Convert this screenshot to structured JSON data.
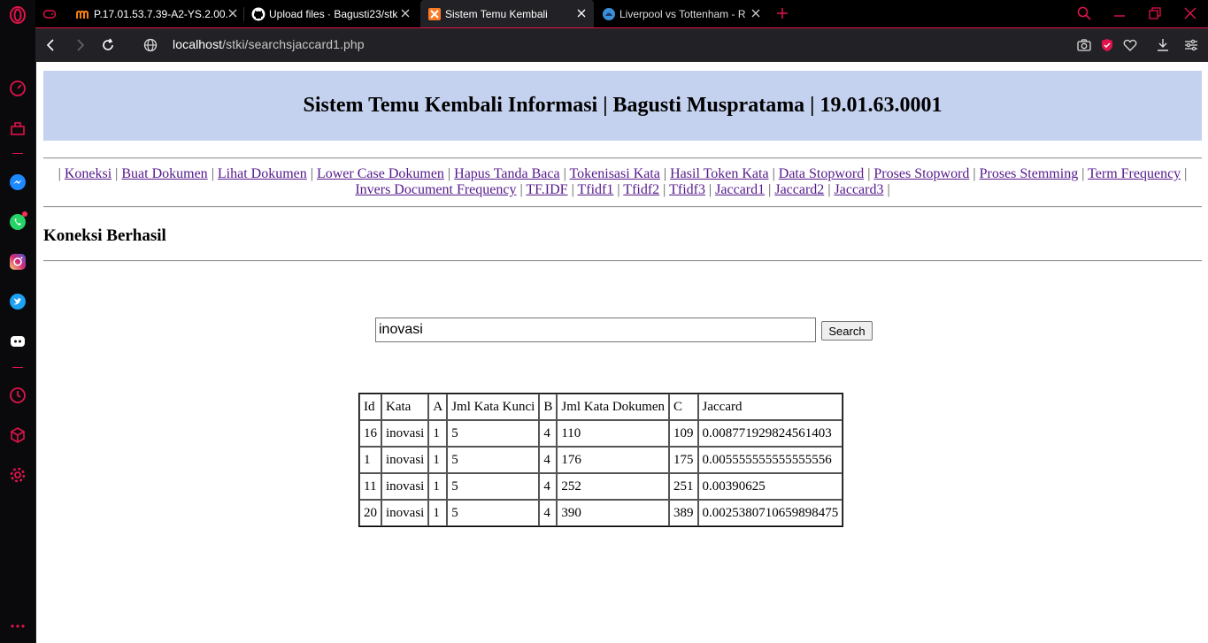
{
  "browser": {
    "tabs": [
      {
        "title": "P.17.01.53.7.39-A2-YS.2.00.",
        "favicon": "moodle-icon"
      },
      {
        "title": "Upload files · Bagusti23/stk",
        "favicon": "github-icon"
      },
      {
        "title": "Sistem Temu Kembali",
        "favicon": "xampp-icon",
        "active": true
      },
      {
        "title": "Liverpool vs Tottenham - R",
        "favicon": "premier-league-icon"
      }
    ],
    "url_host": "localhost",
    "url_path": "/stki/searchsjaccard1.php"
  },
  "header": {
    "title": "Sistem Temu Kembali Informasi | Bagusti Muspratama | 19.01.63.0001",
    "bg_color": "#c5d2ef"
  },
  "nav": {
    "links": [
      "Koneksi",
      "Buat Dokumen",
      "Lihat Dokumen",
      "Lower Case Dokumen",
      "Hapus Tanda Baca",
      "Tokenisasi Kata",
      "Hasil Token Kata",
      "Data Stopword",
      "Proses Stopword",
      "Proses Stemming",
      "Term Frequency",
      "Invers Document Frequency",
      "TF.IDF",
      "Tfidf1",
      "Tfidf2",
      "Tfidf3",
      "Jaccard1",
      "Jaccard2",
      "Jaccard3"
    ],
    "separator": "|"
  },
  "status": {
    "message": "Koneksi Berhasil"
  },
  "search": {
    "value": "inovasi",
    "button_label": "Search"
  },
  "table": {
    "headers": [
      "Id",
      "Kata",
      "A",
      "Jml Kata Kunci",
      "B",
      "Jml Kata Dokumen",
      "C",
      "Jaccard"
    ],
    "rows": [
      [
        "16",
        "inovasi",
        "1",
        "5",
        "4",
        "110",
        "109",
        "0.008771929824561403"
      ],
      [
        "1",
        "inovasi",
        "1",
        "5",
        "4",
        "176",
        "175",
        "0.005555555555555556"
      ],
      [
        "11",
        "inovasi",
        "1",
        "5",
        "4",
        "252",
        "251",
        "0.00390625"
      ],
      [
        "20",
        "inovasi",
        "1",
        "5",
        "4",
        "390",
        "389",
        "0.0025380710659898475"
      ]
    ]
  }
}
